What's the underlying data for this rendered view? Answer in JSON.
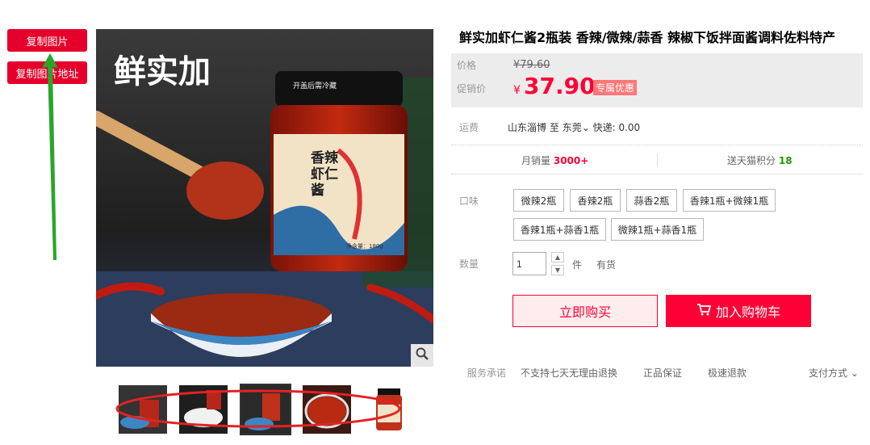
{
  "tools": {
    "copy_image": "复制图片",
    "copy_image_url": "复制图片地址"
  },
  "gallery": {
    "brand_text": "鲜实加",
    "jar_label": "香辣虾仁酱",
    "jar_band": "开盖后需冷藏",
    "jar_net": "净含量：180g"
  },
  "product": {
    "title": "鲜实加虾仁酱2瓶装 香辣/微辣/蒜香 辣椒下饭拌面酱调料佐料特产"
  },
  "price": {
    "label": "价格",
    "original": "¥79.60",
    "promo_label": "促销价",
    "currency": "¥",
    "promo": "37.90",
    "badge": "专属优惠"
  },
  "shipping": {
    "label": "运费",
    "from": "山东淄博",
    "to_word": "至",
    "to": "东莞",
    "method": "快递: 0.00"
  },
  "stats": {
    "monthly_label": "月销量",
    "monthly_value": "3000+",
    "points_label": "送天猫积分",
    "points_value": "18"
  },
  "flavor": {
    "label": "口味",
    "options": [
      "微辣2瓶",
      "香辣2瓶",
      "蒜香2瓶",
      "香辣1瓶+微辣1瓶",
      "香辣1瓶+蒜香1瓶",
      "微辣1瓶+蒜香1瓶"
    ]
  },
  "quantity": {
    "label": "数量",
    "value": "1",
    "unit": "件",
    "stock": "有货"
  },
  "actions": {
    "buy_now": "立即购买",
    "add_to_cart": "加入购物车"
  },
  "service": {
    "label": "服务承诺",
    "items": [
      "不支持七天无理由退换",
      "正品保证",
      "极速退款"
    ],
    "payment": "支付方式"
  },
  "colors": {
    "accent": "#ff0036",
    "copy_button": "#e4002b",
    "annotation_arrow": "#2aa52a",
    "annotation_ellipse": "#e32222"
  }
}
